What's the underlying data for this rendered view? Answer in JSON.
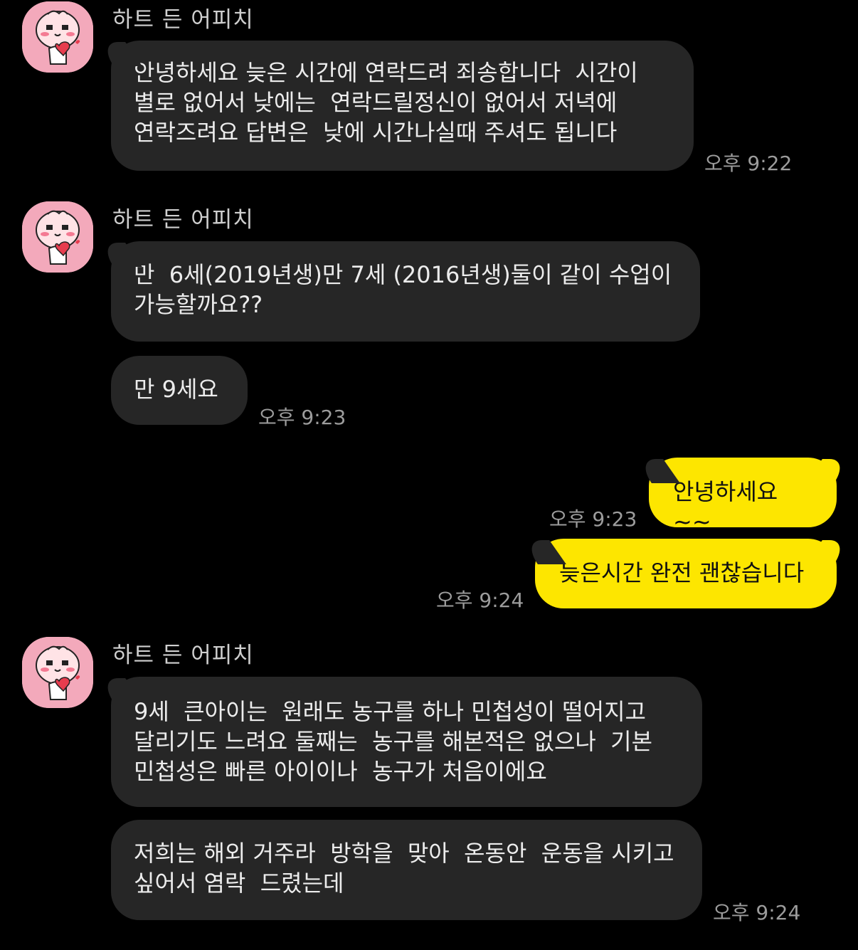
{
  "colors": {
    "background": "#000000",
    "incoming_bubble": "#262626",
    "outgoing_bubble": "#fde600",
    "avatar_bg": "#f3a9bb"
  },
  "messages": {
    "g1": {
      "sender": "하트 든 어피치",
      "m1": "안녕하세요 늦은 시간에 연락드려 죄송합니다  시간이 별로 없어서 낮에는  연락드릴정신이 없어서 저녁에 연락즈려요 답변은  낮에 시간나실때 주셔도 됩니다",
      "time": "오후 9:22"
    },
    "g2": {
      "sender": "하트 든 어피치",
      "m1": "만  6세(2019년생)만 7세 (2016년생)둘이 같이 수업이 가능할까요??",
      "m2": "만 9세요",
      "time": "오후 9:23"
    },
    "me": {
      "m1": "안녕하세요~~",
      "m1_time": "오후 9:23",
      "m2": "늦은시간 완전 괜찮습니다",
      "m2_time": "오후 9:24"
    },
    "g3": {
      "sender": "하트 든 어피치",
      "m1": "9세  큰아이는  원래도 농구를 하나 민첩성이 떨어지고 달리기도 느려요 둘째는  농구를 해본적은 없으나  기본 민첩성은 빠른 아이이나  농구가 처음이에요",
      "m2": "저희는 해외 거주라  방학을  맞아  온동안  운동을 시키고 싶어서 염락  드렸는데",
      "time": "오후 9:24"
    }
  }
}
